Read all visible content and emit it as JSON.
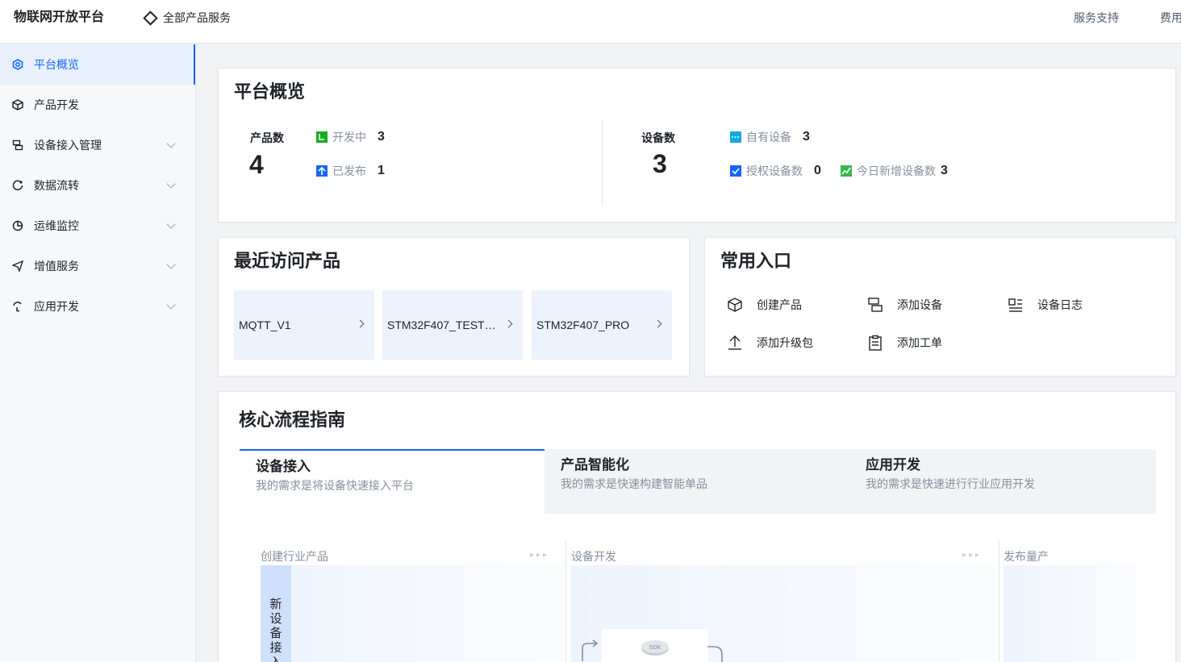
{
  "topbar": {
    "brand": "物联网开放平台",
    "all_products": "全部产品服务",
    "support": "服务支持",
    "fees": "费用"
  },
  "sidebar": {
    "items": [
      {
        "label": "平台概览",
        "icon": "overview-icon",
        "active": true
      },
      {
        "label": "产品开发",
        "icon": "cube-icon"
      },
      {
        "label": "设备接入管理",
        "icon": "device-access-icon"
      },
      {
        "label": "数据流转",
        "icon": "data-flow-icon"
      },
      {
        "label": "运维监控",
        "icon": "pie-chart-icon"
      },
      {
        "label": "增值服务",
        "icon": "send-icon"
      },
      {
        "label": "应用开发",
        "icon": "app-dev-icon"
      }
    ]
  },
  "overview": {
    "title": "平台概览",
    "product_label": "产品数",
    "product_count": "4",
    "developing_label": "开发中",
    "developing_count": "3",
    "published_label": "已发布",
    "published_count": "1",
    "device_label": "设备数",
    "device_count": "3",
    "own_label": "自有设备",
    "own_count": "3",
    "auth_label": "授权设备数",
    "auth_count": "0",
    "new_today_label": "今日新增设备数",
    "new_today_count": "3",
    "colors": {
      "developing": "#1aad19",
      "published": "#1664ff",
      "own": "#14a9e0",
      "auth": "#1664ff",
      "new_today": "#3ab54a"
    }
  },
  "recent": {
    "title": "最近访问产品",
    "items": [
      "MQTT_V1",
      "STM32F407_TEST…",
      "STM32F407_PRO"
    ]
  },
  "entries": {
    "title": "常用入口",
    "items": [
      {
        "label": "创建产品",
        "icon": "cube-icon"
      },
      {
        "label": "添加设备",
        "icon": "add-device-icon"
      },
      {
        "label": "设备日志",
        "icon": "log-list-icon"
      },
      {
        "label": "添加升级包",
        "icon": "upload-icon"
      },
      {
        "label": "添加工单",
        "icon": "clipboard-icon"
      }
    ]
  },
  "guide": {
    "title": "核心流程指南",
    "tabs": [
      {
        "title": "设备接入",
        "sub": "我的需求是将设备快速接入平台",
        "active": true
      },
      {
        "title": "产品智能化",
        "sub": "我的需求是快速构建智能单品"
      },
      {
        "title": "应用开发",
        "sub": "我的需求是快速进行行业应用开发"
      }
    ],
    "steps": [
      "创建行业产品",
      "设备开发",
      "发布量产"
    ],
    "vertical_tab": "新设备接入",
    "sdk_label": "SDK"
  }
}
